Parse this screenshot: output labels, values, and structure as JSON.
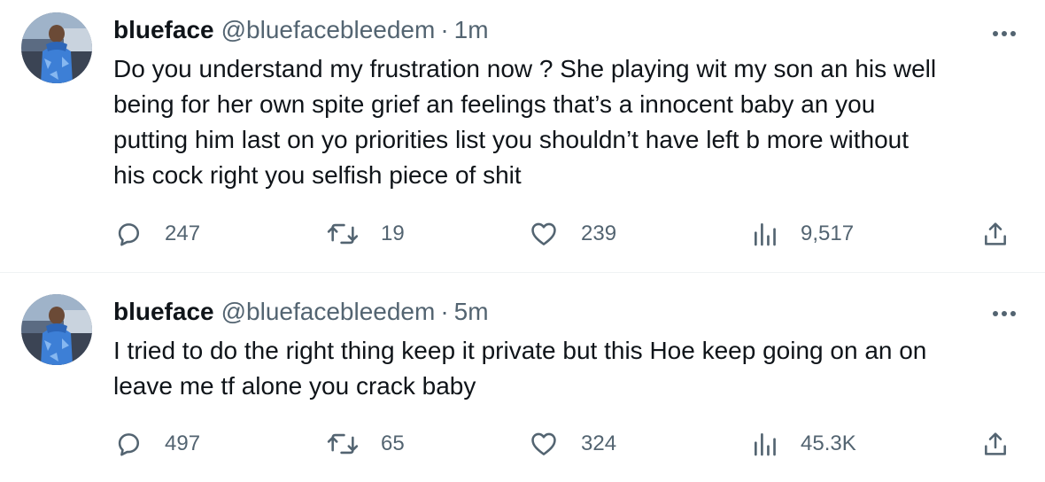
{
  "tweets": [
    {
      "name": "blueface",
      "handle": "@bluefacebleedem",
      "separator": "·",
      "time": "1m",
      "text": "Do you understand my frustration now ? She playing wit my son an his well\nbeing for her own spite grief an feelings that’s a innocent baby an you\nputting him last on yo priorities list you shouldn’t have left b more without\nhis cock right you selfish piece of shit",
      "replies": "247",
      "retweets": "19",
      "likes": "239",
      "views": "9,517"
    },
    {
      "name": "blueface",
      "handle": "@bluefacebleedem",
      "separator": "·",
      "time": "5m",
      "text": "I tried to do the right thing keep it private but this Hoe keep going on an on\nleave me tf alone you crack baby",
      "replies": "497",
      "retweets": "65",
      "likes": "324",
      "views": "45.3K"
    }
  ],
  "icons": {
    "reply": "reply-icon",
    "retweet": "retweet-icon",
    "like": "heart-icon",
    "views": "views-bar-chart-icon",
    "share": "share-icon",
    "more": "more-dots-icon"
  },
  "colors": {
    "text": "#0f1419",
    "secondary": "#536471",
    "divider": "#eff3f4",
    "avatar_blue": "#3d7fd6"
  }
}
